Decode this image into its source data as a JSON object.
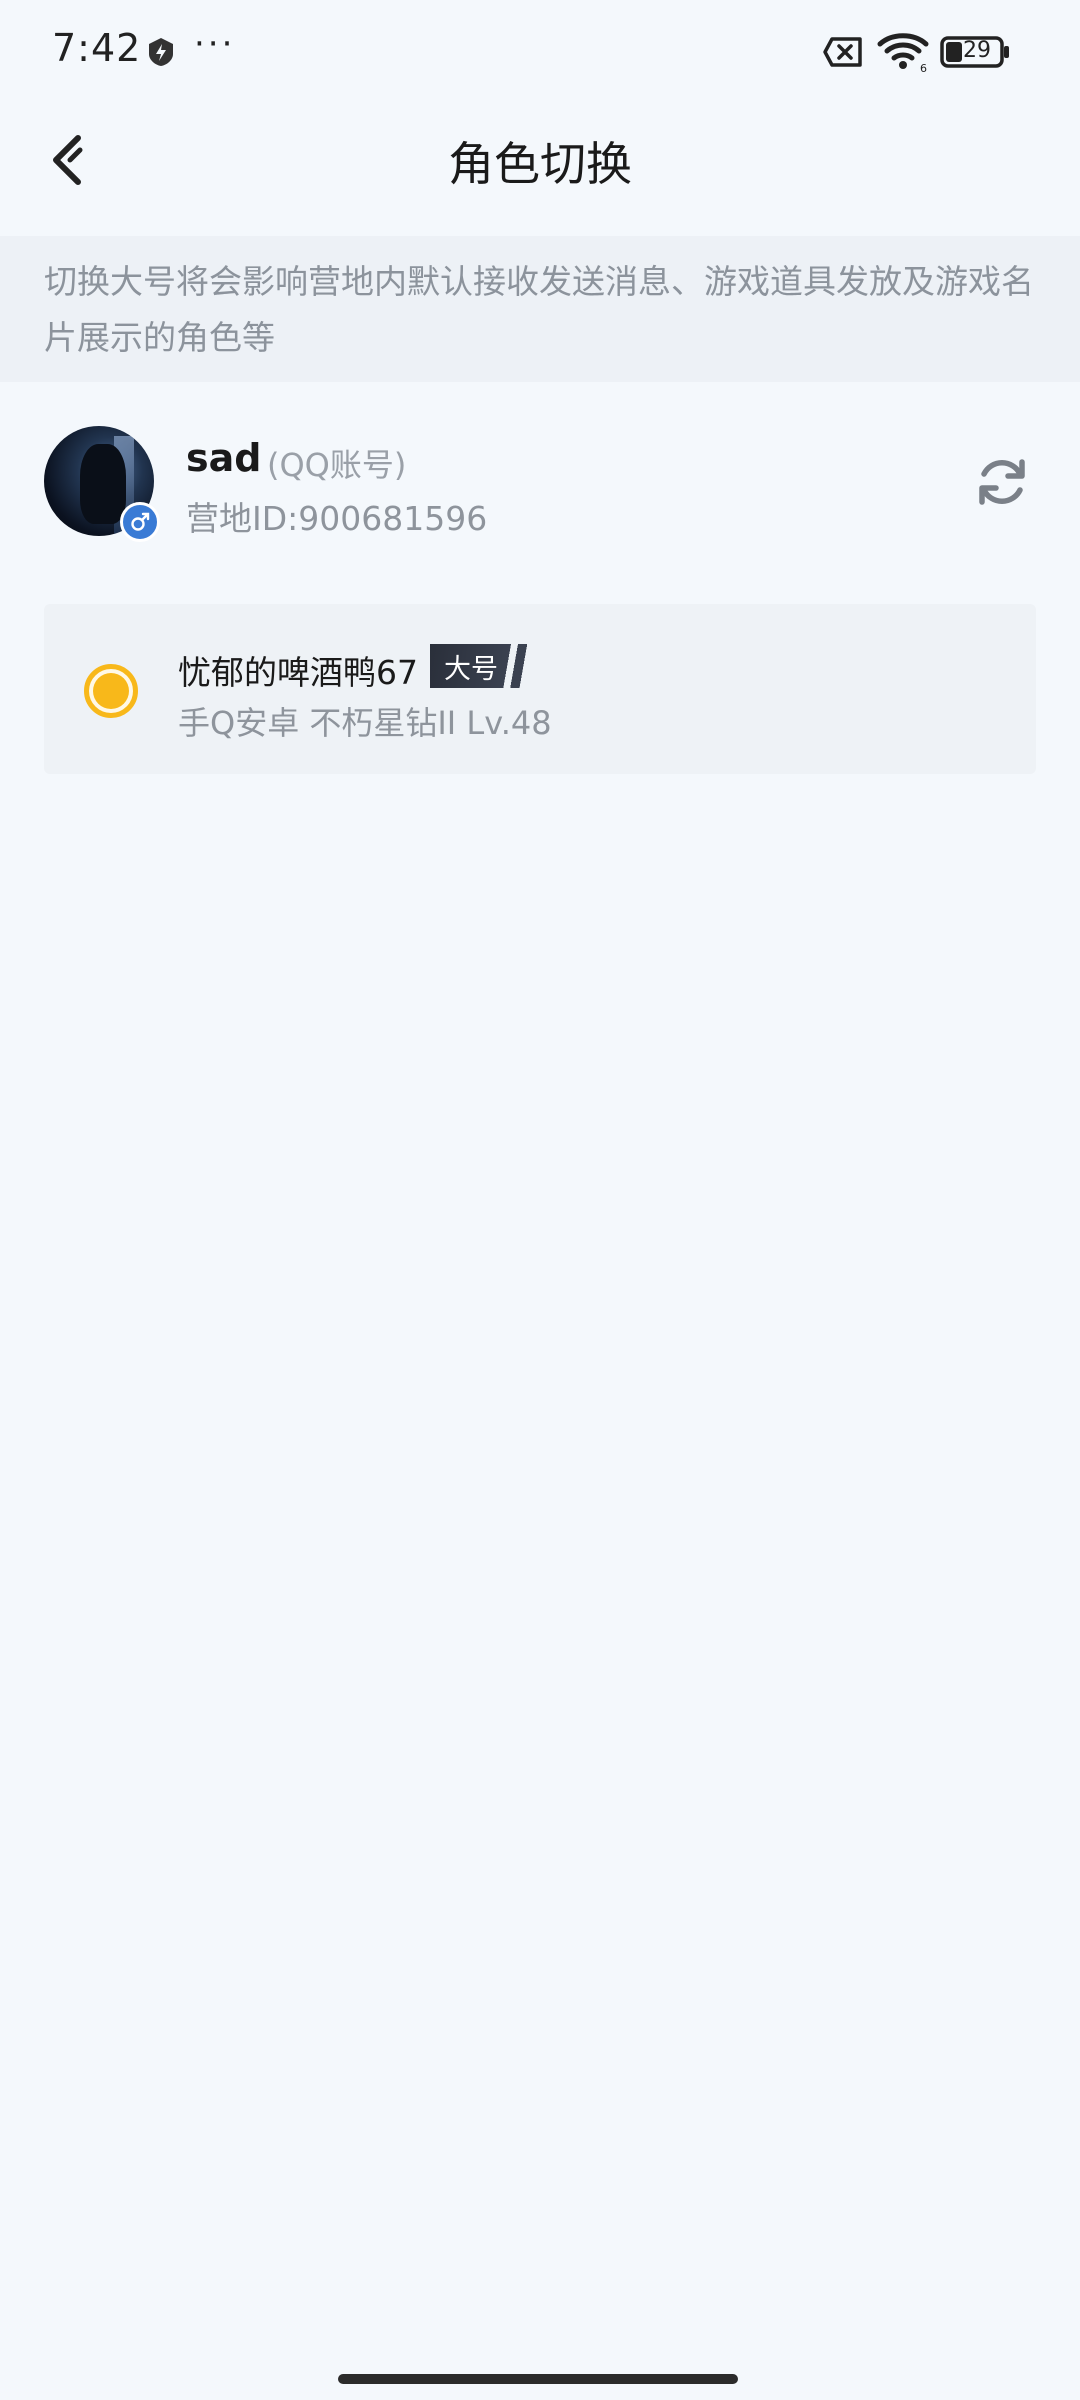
{
  "status": {
    "time": "7:42",
    "dots": "···",
    "battery": "29"
  },
  "nav": {
    "title": "角色切换"
  },
  "notice": {
    "text": "切换大号将会影响营地内默认接收发送消息、游戏道具发放及游戏名片展示的角色等"
  },
  "account": {
    "name": "sad",
    "type": "(QQ账号)",
    "id": "营地ID:900681596"
  },
  "roles": [
    {
      "name": "忧郁的啤酒鸭67",
      "badge": "大号",
      "detail": "手Q安卓  不朽星钻II  Lv.48",
      "selected": true
    }
  ],
  "colors": {
    "accent": "#f8b81a",
    "background": "#f4f8fc"
  }
}
